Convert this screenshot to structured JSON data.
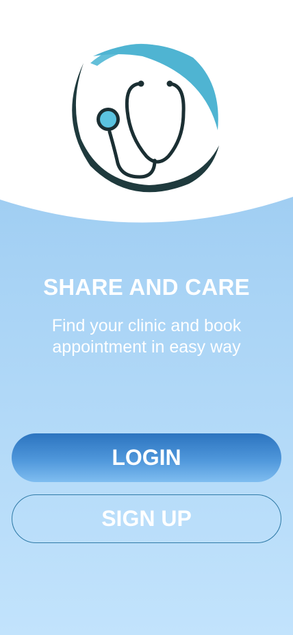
{
  "app": {
    "logo_icon": "stethoscope-icon",
    "title": "SHARE AND CARE",
    "subtitle": "Find your clinic and book appointment in easy way"
  },
  "buttons": {
    "login_label": "LOGIN",
    "signup_label": "SIGN UP"
  },
  "colors": {
    "brand_teal": "#5bbcd7",
    "brand_dark": "#1f3a3d",
    "login_blue": "#2c74bf",
    "background_light_blue": "#a8d3f5"
  }
}
